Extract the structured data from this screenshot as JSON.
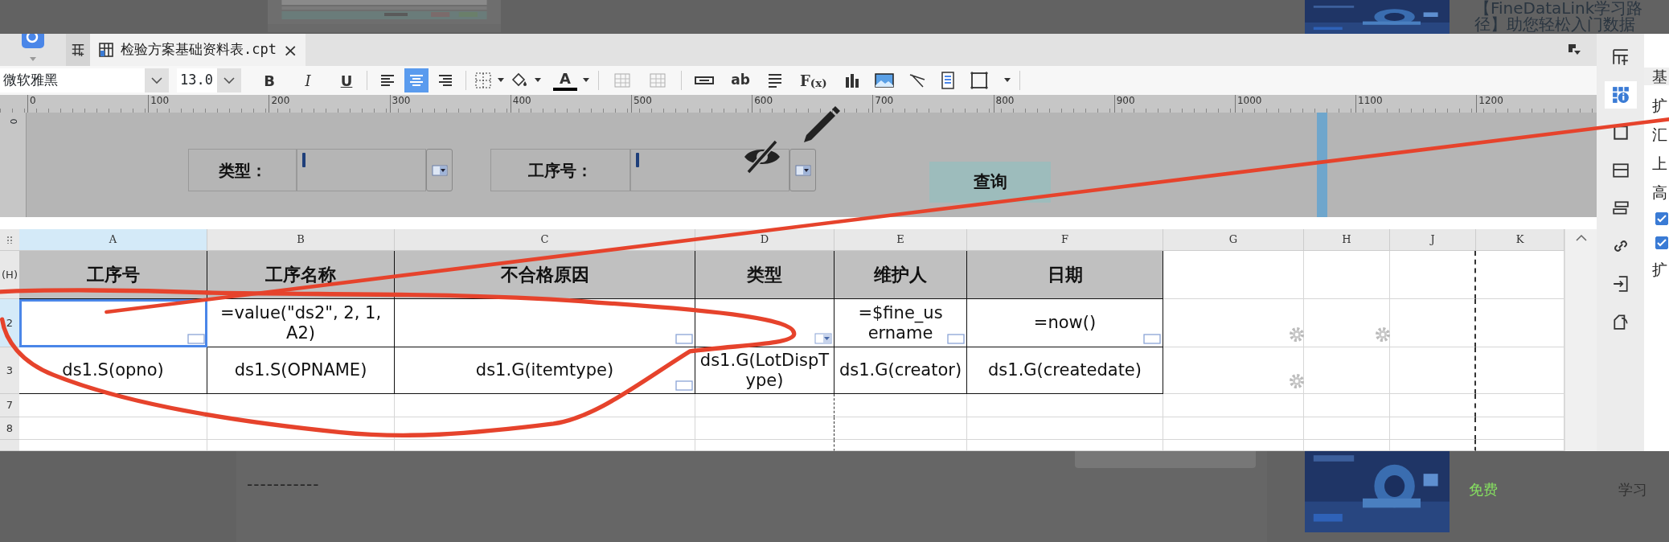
{
  "backdrop": {
    "heading_lines": [
      "【FineDataLink学习路",
      "径】助您轻松入门数据"
    ],
    "dashes": "-----------",
    "price": "免费",
    "tag": "学习"
  },
  "tabs": [
    {
      "label": "检验方案基础资料表.cpt",
      "selected": true,
      "close": "×"
    }
  ],
  "toolbar": {
    "font": "微软雅黑",
    "size": "13.0",
    "style_buttons": [
      "B",
      "I",
      "U"
    ],
    "align_buttons": [
      {
        "selected": false
      },
      {
        "selected": true
      },
      {
        "selected": false
      }
    ],
    "font_color": "A",
    "text_tool": "ab",
    "formula_tool": "F$_{(x)}$"
  },
  "ruler": {
    "side_zero": "0",
    "ticks": [
      "0",
      "100",
      "200",
      "300",
      "400",
      "500",
      "600",
      "700",
      "800",
      "900",
      "1000",
      "1100",
      "1200"
    ]
  },
  "parameters": [
    {
      "label": "类型："
    },
    {
      "label": "工序号："
    }
  ],
  "query_button": "查询",
  "sheet": {
    "columns": [
      {
        "label": "A",
        "selected": true
      },
      {
        "label": "B",
        "selected": false
      },
      {
        "label": "C",
        "selected": false
      },
      {
        "label": "D",
        "selected": false
      },
      {
        "label": "E",
        "selected": false
      },
      {
        "label": "F",
        "selected": false
      },
      {
        "label": "G",
        "selected": false
      },
      {
        "label": "H",
        "selected": false
      },
      {
        "label": "J",
        "selected": false
      },
      {
        "label": "K",
        "selected": false
      }
    ],
    "rows": [
      {
        "number": "(H)",
        "selected": false,
        "kind": "header",
        "cells": [
          {
            "text": "工序号"
          },
          {
            "text": "工序名称"
          },
          {
            "text": "不合格原因"
          },
          {
            "text": "类型"
          },
          {
            "text": "维护人"
          },
          {
            "text": "日期"
          }
        ]
      },
      {
        "number": "2",
        "selected": true,
        "kind": "data",
        "cells": [
          {
            "kind": "box",
            "selected": true
          },
          {
            "kind": "plain",
            "text": "=value(\"ds2\", 2, 1, A2)",
            "selected": false
          },
          {
            "kind": "box",
            "selected": false
          },
          {
            "kind": "dropdown",
            "selected": false
          },
          {
            "kind": "box",
            "text": "=$fine_username",
            "selected": false
          },
          {
            "kind": "box",
            "text": "=now()",
            "selected": false
          },
          {
            "kind": "gear",
            "selected": false
          },
          {
            "kind": "gear",
            "selected": false
          }
        ]
      },
      {
        "number": "3",
        "selected": false,
        "kind": "data",
        "cells": [
          {
            "kind": "plain",
            "text": "ds1.S(opno)",
            "selected": false
          },
          {
            "kind": "plain",
            "text": "ds1.S(OPNAME)",
            "selected": false
          },
          {
            "kind": "box",
            "text": "ds1.G(itemtype)",
            "selected": false
          },
          {
            "kind": "plain",
            "text": "ds1.G(LotDispType)",
            "selected": false
          },
          {
            "kind": "plain",
            "text": "ds1.G(creator)",
            "selected": false
          },
          {
            "kind": "plain",
            "text": "ds1.G(createdate)",
            "selected": false
          },
          {
            "kind": "gear",
            "selected": false
          }
        ]
      },
      {
        "number": "7",
        "selected": false,
        "kind": "empty",
        "cells": []
      },
      {
        "number": "8",
        "selected": false,
        "kind": "empty",
        "cells": []
      }
    ]
  },
  "side_panel": [
    {
      "kind": "label",
      "text": "基"
    },
    {
      "kind": "label",
      "text": "扩"
    },
    {
      "kind": "label",
      "text": "汇"
    },
    {
      "kind": "label",
      "text": "上"
    },
    {
      "kind": "label",
      "text": "高"
    },
    {
      "kind": "checkbox",
      "checked": true
    },
    {
      "kind": "checkbox",
      "checked": true
    },
    {
      "kind": "label",
      "text": "扩"
    }
  ]
}
